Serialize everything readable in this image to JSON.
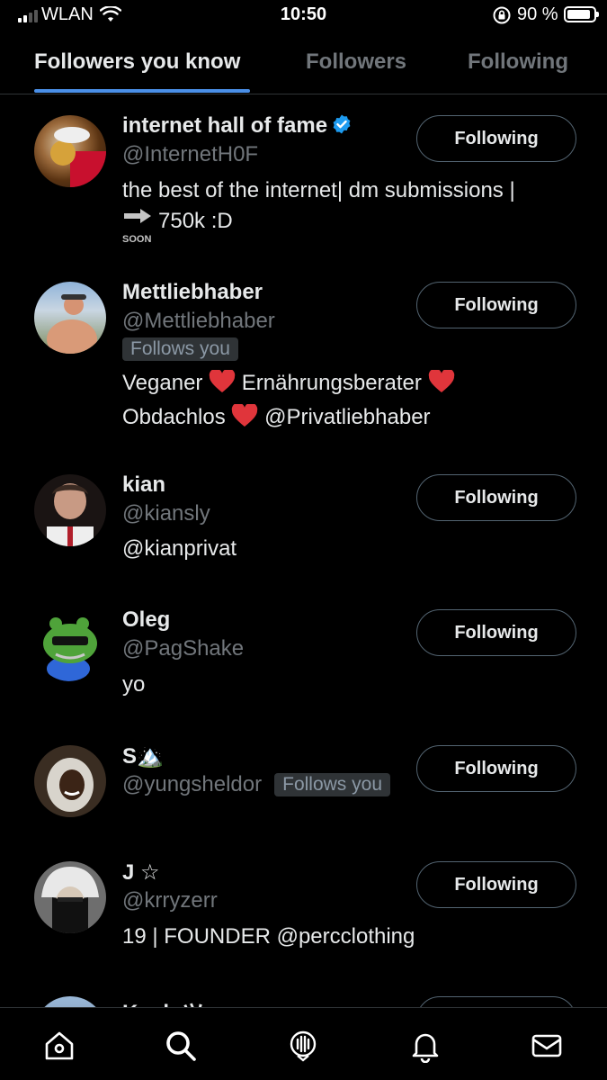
{
  "status_bar": {
    "carrier": "WLAN",
    "time": "10:50",
    "battery": "90 %",
    "battery_level": 0.9
  },
  "tabs": [
    {
      "label": "Followers you know",
      "active": true
    },
    {
      "label": "Followers",
      "active": false
    },
    {
      "label": "Following",
      "active": false
    }
  ],
  "users": [
    {
      "name": "internet hall of fame",
      "verified": true,
      "handle": "@InternetH0F",
      "follows_you": false,
      "bio_lines": [
        "the best of the internet| dm submissions |",
        "750k :D"
      ],
      "bio_prefix_icon": "soon-arrow-icon",
      "soon_label": "SOON",
      "button": "Following"
    },
    {
      "name": "Mettliebhaber",
      "handle": "@Mettliebhaber",
      "follows_you": true,
      "follows_you_label": "Follows you",
      "bio_lines": [
        "Veganer ❤️ Ernährungsberater ❤️",
        "Obdachlos ❤️ @Privatliebhaber"
      ],
      "button": "Following"
    },
    {
      "name": "kian",
      "handle": "@kiansly",
      "follows_you": false,
      "bio_lines": [
        "@kianprivat"
      ],
      "button": "Following"
    },
    {
      "name": "Oleg",
      "handle": "@PagShake",
      "follows_you": false,
      "bio_lines": [
        "yo"
      ],
      "button": "Following"
    },
    {
      "name": "S🏔️",
      "handle": "@yungsheldor",
      "follows_you": true,
      "follows_you_label": "Follows you",
      "bio_lines": [],
      "button": "Following"
    },
    {
      "name": "J ☆",
      "handle": "@krryzerr",
      "follows_you": false,
      "bio_lines": [
        "19 | FOUNDER @percclothing"
      ],
      "button": "Following"
    }
  ],
  "partial_user": {
    "name": "Kenh ツ"
  },
  "bottom_nav": [
    "home-icon",
    "search-icon",
    "spaces-icon",
    "notifications-icon",
    "messages-icon"
  ],
  "colors": {
    "background": "#000000",
    "accent": "#1d9bf0",
    "tab_underline": "#4a8fe7",
    "heart": "#e0353b"
  }
}
